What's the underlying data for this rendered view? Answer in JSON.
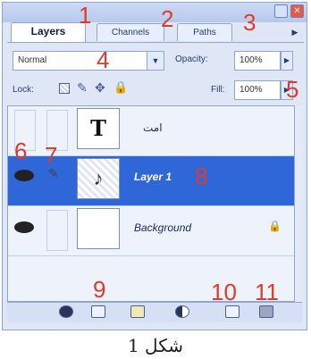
{
  "tabs": {
    "layers": "Layers",
    "channels": "Channels",
    "paths": "Paths"
  },
  "controls": {
    "blend_mode": "Normal",
    "opacity_label": "Opacity:",
    "opacity_value": "100%",
    "lock_label": "Lock:",
    "fill_label": "Fill:",
    "fill_value": "100%"
  },
  "layers": [
    {
      "name": "امت",
      "thumb_glyph": "T",
      "selected": false
    },
    {
      "name": "Layer 1",
      "selected": true
    },
    {
      "name": "Background",
      "selected": false
    }
  ],
  "annotations": {
    "n1": "1",
    "n2": "2",
    "n3": "3",
    "n4": "4",
    "n5": "5",
    "n6": "6",
    "n7": "7",
    "n8": "8",
    "n9": "9",
    "n10": "10",
    "n11": "11"
  },
  "caption": "شکل 1",
  "colors": {
    "panel": "#dfe7f7",
    "selection": "#2f67d8",
    "annotation": "#e23a2a"
  }
}
